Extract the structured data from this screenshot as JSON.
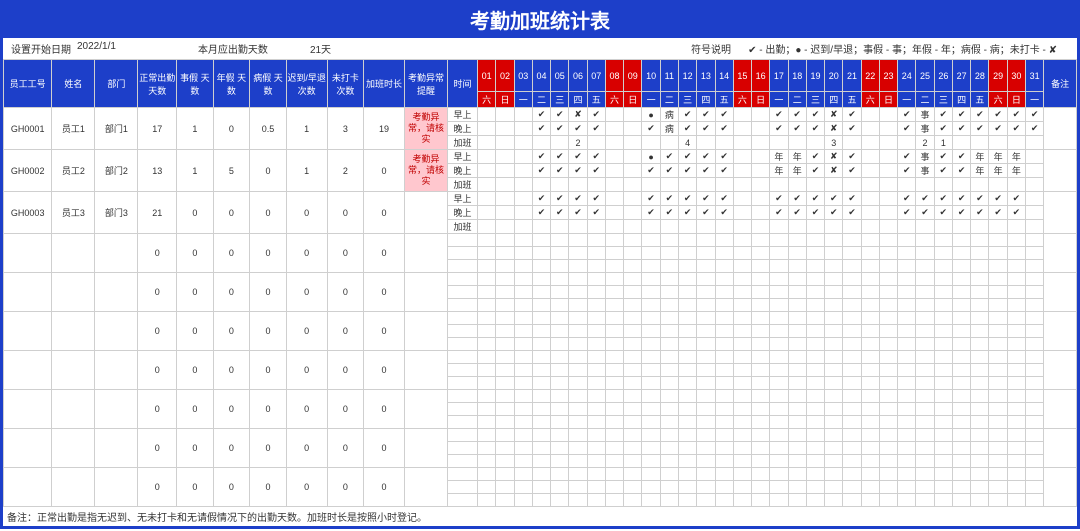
{
  "title": "考勤加班统计表",
  "meta": {
    "startLabel": "设置开始日期",
    "startDate": "2022/1/1",
    "monthDaysLabel": "本月应出勤天数",
    "monthDays": "21天",
    "legendLabel": "符号说明",
    "legendText": "✔ - 出勤；● - 迟到/早退；事假 - 事；年假 - 年；病假 - 病；未打卡 - ✘"
  },
  "headers": {
    "empId": "员工工号",
    "name": "姓名",
    "dept": "部门",
    "normal": "正常出勤\n天数",
    "personal": "事假\n天数",
    "annual": "年假\n天数",
    "sick": "病假\n天数",
    "late": "迟到/早退\n次数",
    "nocard": "未打卡\n次数",
    "ot": "加班时长",
    "abnormal": "考勤异常\n提醒",
    "time": "时间",
    "remark": "备注"
  },
  "days": [
    {
      "d": "01",
      "w": "六",
      "r": 1
    },
    {
      "d": "02",
      "w": "日",
      "r": 1
    },
    {
      "d": "03",
      "w": "一",
      "r": 0
    },
    {
      "d": "04",
      "w": "二",
      "r": 0
    },
    {
      "d": "05",
      "w": "三",
      "r": 0
    },
    {
      "d": "06",
      "w": "四",
      "r": 0
    },
    {
      "d": "07",
      "w": "五",
      "r": 0
    },
    {
      "d": "08",
      "w": "六",
      "r": 1
    },
    {
      "d": "09",
      "w": "日",
      "r": 1
    },
    {
      "d": "10",
      "w": "一",
      "r": 0
    },
    {
      "d": "11",
      "w": "二",
      "r": 0
    },
    {
      "d": "12",
      "w": "三",
      "r": 0
    },
    {
      "d": "13",
      "w": "四",
      "r": 0
    },
    {
      "d": "14",
      "w": "五",
      "r": 0
    },
    {
      "d": "15",
      "w": "六",
      "r": 1
    },
    {
      "d": "16",
      "w": "日",
      "r": 1
    },
    {
      "d": "17",
      "w": "一",
      "r": 0
    },
    {
      "d": "18",
      "w": "二",
      "r": 0
    },
    {
      "d": "19",
      "w": "三",
      "r": 0
    },
    {
      "d": "20",
      "w": "四",
      "r": 0
    },
    {
      "d": "21",
      "w": "五",
      "r": 0
    },
    {
      "d": "22",
      "w": "六",
      "r": 1
    },
    {
      "d": "23",
      "w": "日",
      "r": 1
    },
    {
      "d": "24",
      "w": "一",
      "r": 0
    },
    {
      "d": "25",
      "w": "二",
      "r": 0
    },
    {
      "d": "26",
      "w": "三",
      "r": 0
    },
    {
      "d": "27",
      "w": "四",
      "r": 0
    },
    {
      "d": "28",
      "w": "五",
      "r": 0
    },
    {
      "d": "29",
      "w": "六",
      "r": 1
    },
    {
      "d": "30",
      "w": "日",
      "r": 1
    },
    {
      "d": "31",
      "w": "一",
      "r": 0
    }
  ],
  "timeRows": [
    "早上",
    "晚上",
    "加班"
  ],
  "employees": [
    {
      "id": "GH0001",
      "name": "员工1",
      "dept": "部门1",
      "normal": "17",
      "personal": "1",
      "annual": "0",
      "sick": "0.5",
      "late": "1",
      "nocard": "3",
      "ot": "19",
      "alert": "考勤异常，请核实",
      "marks": {
        "m": [
          "",
          "",
          "",
          "✔",
          "✔",
          "✘",
          "✔",
          "",
          "",
          "●",
          "病",
          "✔",
          "✔",
          "✔",
          "",
          "",
          "✔",
          "✔",
          "✔",
          "✘",
          "✔",
          "",
          "",
          "✔",
          "事",
          "✔",
          "✔",
          "✔",
          "✔",
          "✔",
          "✔"
        ],
        "e": [
          "",
          "",
          "",
          "✔",
          "✔",
          "✔",
          "✔",
          "",
          "",
          "✔",
          "病",
          "✔",
          "✔",
          "✔",
          "",
          "",
          "✔",
          "✔",
          "✔",
          "✘",
          "✔",
          "",
          "",
          "✔",
          "事",
          "✔",
          "✔",
          "✔",
          "✔",
          "✔",
          "✔"
        ],
        "o": [
          "",
          "",
          "",
          "",
          "",
          "2",
          "",
          "",
          "",
          "",
          "",
          "4",
          "",
          "",
          "",
          "",
          "",
          "",
          "",
          "3",
          "",
          "",
          "",
          "",
          "2",
          "1",
          "",
          "",
          "",
          "",
          ""
        ]
      }
    },
    {
      "id": "GH0002",
      "name": "员工2",
      "dept": "部门2",
      "normal": "13",
      "personal": "1",
      "annual": "5",
      "sick": "0",
      "late": "1",
      "nocard": "2",
      "ot": "0",
      "alert": "考勤异常，请核实",
      "marks": {
        "m": [
          "",
          "",
          "",
          "✔",
          "✔",
          "✔",
          "✔",
          "",
          "",
          "●",
          "✔",
          "✔",
          "✔",
          "✔",
          "",
          "",
          "年",
          "年",
          "✔",
          "✘",
          "✔",
          "",
          "",
          "✔",
          "事",
          "✔",
          "✔",
          "年",
          "年",
          "年",
          ""
        ],
        "e": [
          "",
          "",
          "",
          "✔",
          "✔",
          "✔",
          "✔",
          "",
          "",
          "✔",
          "✔",
          "✔",
          "✔",
          "✔",
          "",
          "",
          "年",
          "年",
          "✔",
          "✘",
          "✔",
          "",
          "",
          "✔",
          "事",
          "✔",
          "✔",
          "年",
          "年",
          "年",
          ""
        ],
        "o": [
          "",
          "",
          "",
          "",
          "",
          "",
          "",
          "",
          "",
          "",
          "",
          "",
          "",
          "",
          "",
          "",
          "",
          "",
          "",
          "",
          "",
          "",
          "",
          "",
          "",
          "",
          "",
          "",
          "",
          "",
          ""
        ]
      }
    },
    {
      "id": "GH0003",
      "name": "员工3",
      "dept": "部门3",
      "normal": "21",
      "personal": "0",
      "annual": "0",
      "sick": "0",
      "late": "0",
      "nocard": "0",
      "ot": "0",
      "alert": "",
      "marks": {
        "m": [
          "",
          "",
          "",
          "✔",
          "✔",
          "✔",
          "✔",
          "",
          "",
          "✔",
          "✔",
          "✔",
          "✔",
          "✔",
          "",
          "",
          "✔",
          "✔",
          "✔",
          "✔",
          "✔",
          "",
          "",
          "✔",
          "✔",
          "✔",
          "✔",
          "✔",
          "✔",
          "✔",
          ""
        ],
        "e": [
          "",
          "",
          "",
          "✔",
          "✔",
          "✔",
          "✔",
          "",
          "",
          "✔",
          "✔",
          "✔",
          "✔",
          "✔",
          "",
          "",
          "✔",
          "✔",
          "✔",
          "✔",
          "✔",
          "",
          "",
          "✔",
          "✔",
          "✔",
          "✔",
          "✔",
          "✔",
          "✔",
          ""
        ],
        "o": [
          "",
          "",
          "",
          "",
          "",
          "",
          "",
          "",
          "",
          "",
          "",
          "",
          "",
          "",
          "",
          "",
          "",
          "",
          "",
          "",
          "",
          "",
          "",
          "",
          "",
          "",
          "",
          "",
          "",
          "",
          ""
        ]
      }
    }
  ],
  "emptyRows": 7,
  "emptyCells": [
    "0",
    "0",
    "0",
    "0",
    "0",
    "0",
    "0"
  ],
  "footer": "备注：正常出勤是指无迟到、无未打卡和无请假情况下的出勤天数。加班时长是按照小时登记。"
}
